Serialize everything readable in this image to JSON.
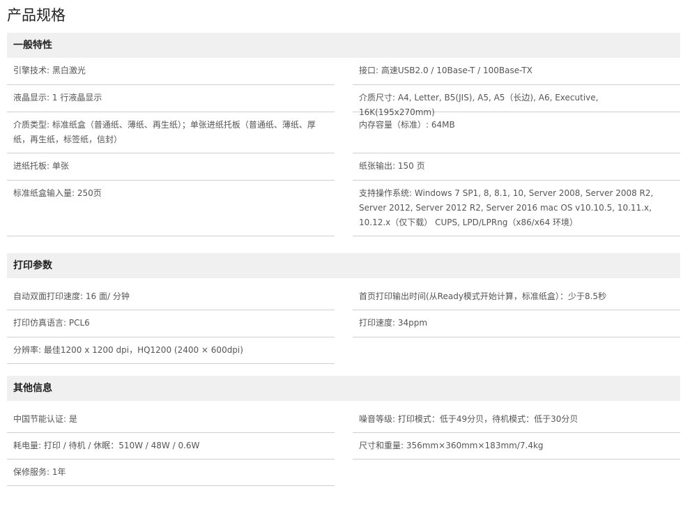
{
  "page": {
    "title": "产品规格"
  },
  "sections": [
    {
      "title": "一般特性",
      "left": [
        {
          "label": "引擎技术",
          "value": "黑白激光"
        },
        {
          "label": "液晶显示",
          "value": "1 行液晶显示"
        },
        {
          "label": "介质类型",
          "value": "标准纸盒（普通纸、薄纸、再生纸）；单张进纸托板（普通纸、薄纸、厚纸，再生纸，标签纸，信封）"
        },
        {
          "label": "进纸托板",
          "value": "单张"
        },
        {
          "label": "标准纸盒输入量",
          "value": "250页"
        }
      ],
      "right": [
        {
          "label": "接口",
          "value": "高速USB2.0 / 10Base-T / 100Base-TX"
        },
        {
          "label": "介质尺寸",
          "value": "A4, Letter, B5(JIS), A5, A5（长边), A6, Executive, 16K(195x270mm)"
        },
        {
          "label": "内存容量（标准）",
          "value": "64MB"
        },
        {
          "label": "纸张输出",
          "value": "150 页"
        },
        {
          "label": "支持操作系统",
          "value": "Windows 7 SP1, 8, 8.1, 10, Server 2008, Server 2008 R2, Server 2012, Server 2012 R2, Server 2016 mac OS v10.10.5, 10.11.x, 10.12.x（仅下载） CUPS, LPD/LPRng（x86/x64 环境）"
        }
      ]
    },
    {
      "title": "打印参数",
      "left": [
        {
          "label": "自动双面打印速度",
          "value": "16 面/ 分钟"
        },
        {
          "label": "打印仿真语言",
          "value": "PCL6"
        },
        {
          "label": "分辨率",
          "value": "最佳1200 x 1200 dpi，HQ1200 (2400 × 600dpi)"
        }
      ],
      "right": [
        {
          "label": "首页打印输出时间(从Ready模式开始计算，标准纸盒）",
          "value": "少于8.5秒"
        },
        {
          "label": "打印速度",
          "value": "34ppm"
        }
      ]
    },
    {
      "title": "其他信息",
      "left": [
        {
          "label": "中国节能认证",
          "value": "是"
        },
        {
          "label": "耗电量",
          "value": "打印 / 待机 / 休眠：510W / 48W / 0.6W"
        },
        {
          "label": "保修服务",
          "value": "1年"
        }
      ],
      "right": [
        {
          "label": "噪音等级",
          "value": "打印模式：低于49分贝，待机模式：低于30分贝"
        },
        {
          "label": "尺寸和重量",
          "value": "356mm×360mm×183mm/7.4kg"
        }
      ]
    }
  ]
}
